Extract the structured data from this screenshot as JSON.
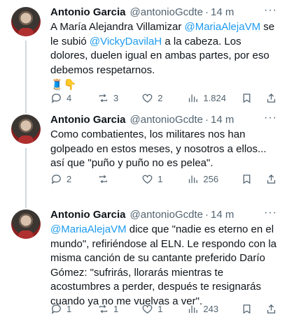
{
  "tweets": [
    {
      "name": "Antonio Garcia",
      "handle": "@antonioGcdte",
      "sep": "·",
      "time": "14 m",
      "text_parts": [
        "A María Alejandra Villamizar ",
        "@MariaAlejaVM",
        " se le subió ",
        "@VickyDavilaH",
        " a la cabeza. Los dolores, duelen igual en ambas partes, por eso debemos respetarnos."
      ],
      "emoji": "🧵👇",
      "replies": "4",
      "retweets": "3",
      "likes": "2",
      "views": "1.824"
    },
    {
      "name": "Antonio Garcia",
      "handle": "@antonioGcdte",
      "sep": "·",
      "time": "14 m",
      "text": "Como combatientes, los militares nos han golpeado en estos meses, y nosotros a ellos... así que \"puño y puño no es pelea\".",
      "replies": "2",
      "retweets": "",
      "likes": "1",
      "views": "256"
    },
    {
      "name": "Antonio Garcia",
      "handle": "@antonioGcdte",
      "sep": "·",
      "time": "14 m",
      "text_parts": [
        "@MariaAlejaVM",
        " dice que \"nadie es eterno en el mundo\", refiriéndose al ELN. Le respondo con la misma canción de su cantante preferido Darío Gómez: \"sufrirás, llorarás mientras te acostumbres a perder, después te resignarás cuando ya no me vuelvas a ver\"."
      ],
      "replies": "1",
      "retweets": "1",
      "likes": "1",
      "views": "243"
    }
  ]
}
